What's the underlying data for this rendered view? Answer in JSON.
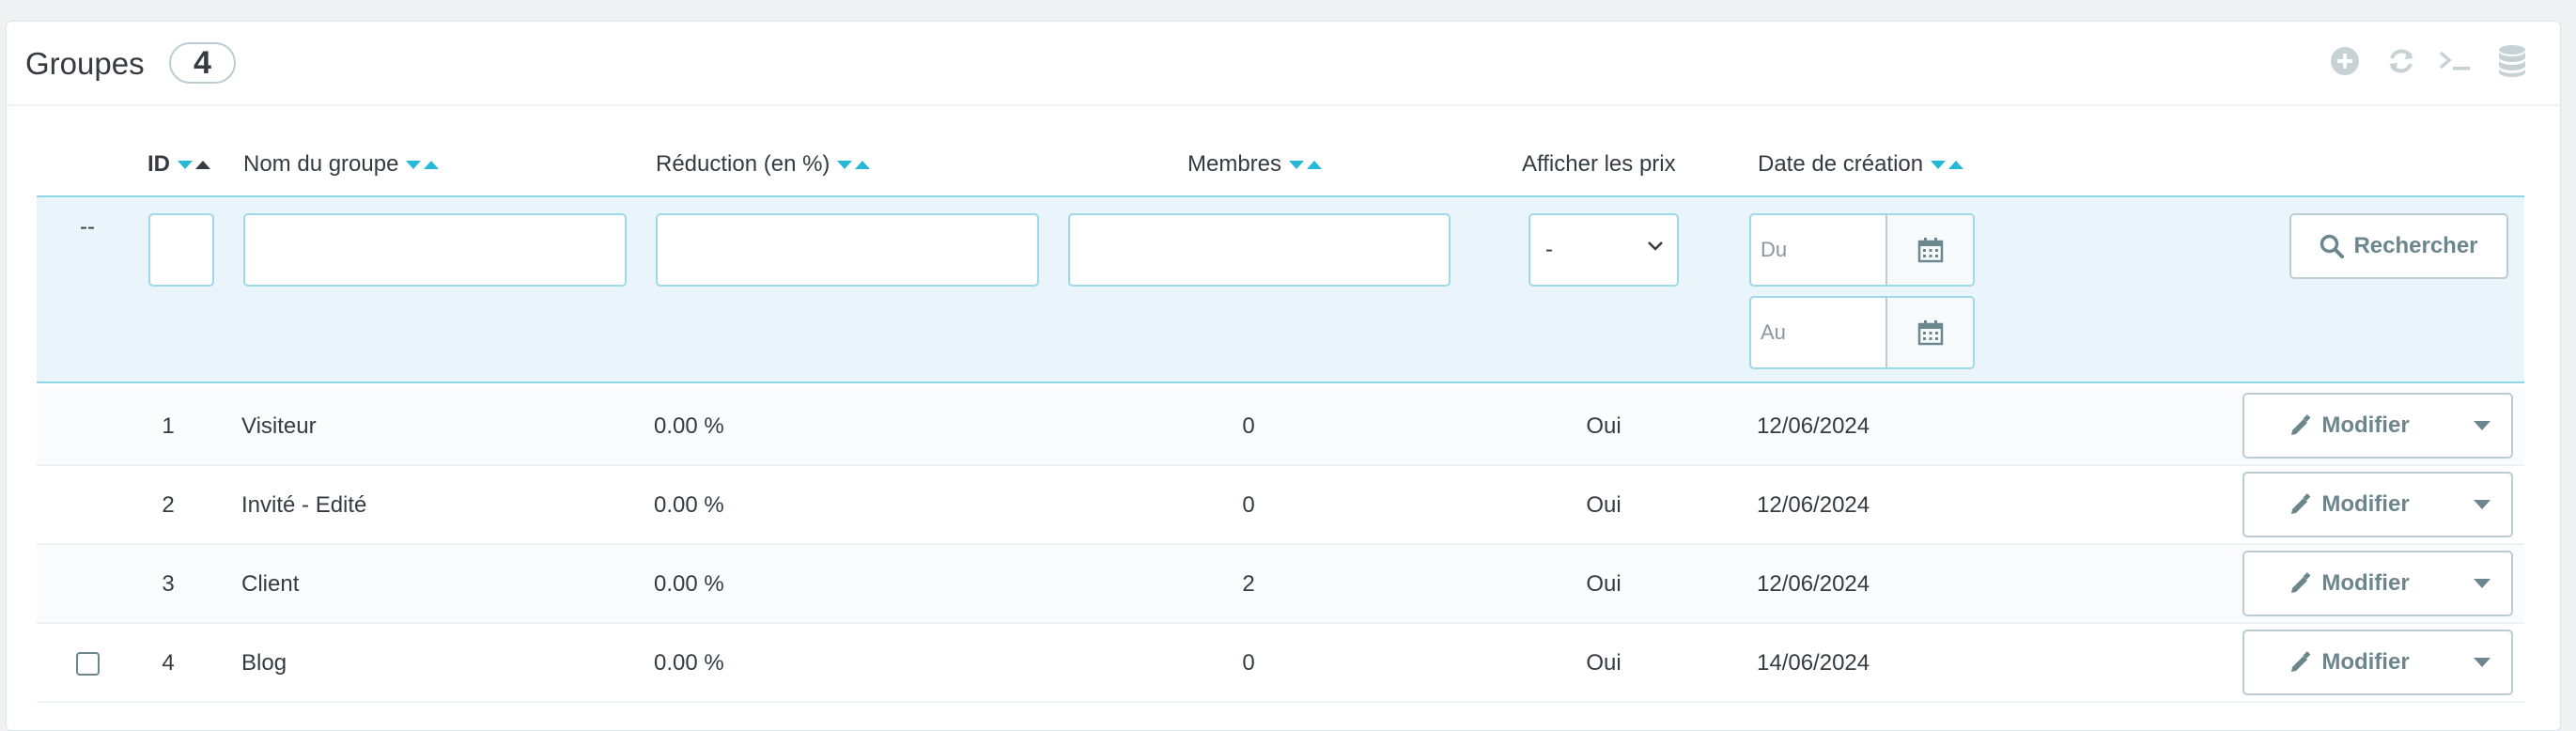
{
  "panel": {
    "title": "Groupes",
    "count": "4"
  },
  "toolbar": {
    "icons": [
      "add-icon",
      "refresh-icon",
      "sql-terminal-icon",
      "database-icon"
    ]
  },
  "columns": {
    "id": "ID",
    "name": "Nom du groupe",
    "reduction": "Réduction (en %)",
    "members": "Membres",
    "show_prices": "Afficher les prix",
    "date": "Date de création"
  },
  "filters": {
    "dash": "--",
    "show_prices_selected": "-",
    "date_from_placeholder": "Du",
    "date_to_placeholder": "Au",
    "search_label": "Rechercher"
  },
  "rows": [
    {
      "id": "1",
      "name": "Visiteur",
      "reduction": "0.00 %",
      "members": "0",
      "show_prices": "Oui",
      "date": "12/06/2024",
      "action": "Modifier",
      "checkbox": false
    },
    {
      "id": "2",
      "name": "Invité - Edité",
      "reduction": "0.00 %",
      "members": "0",
      "show_prices": "Oui",
      "date": "12/06/2024",
      "action": "Modifier",
      "checkbox": false
    },
    {
      "id": "3",
      "name": "Client",
      "reduction": "0.00 %",
      "members": "2",
      "show_prices": "Oui",
      "date": "12/06/2024",
      "action": "Modifier",
      "checkbox": false
    },
    {
      "id": "4",
      "name": "Blog",
      "reduction": "0.00 %",
      "members": "0",
      "show_prices": "Oui",
      "date": "14/06/2024",
      "action": "Modifier",
      "checkbox": true
    }
  ],
  "colors": {
    "accent": "#25b9d7",
    "filter_bg": "#eaf4fb",
    "border": "#bbcdd2",
    "text": "#363a41",
    "button_text": "#6c868e"
  }
}
